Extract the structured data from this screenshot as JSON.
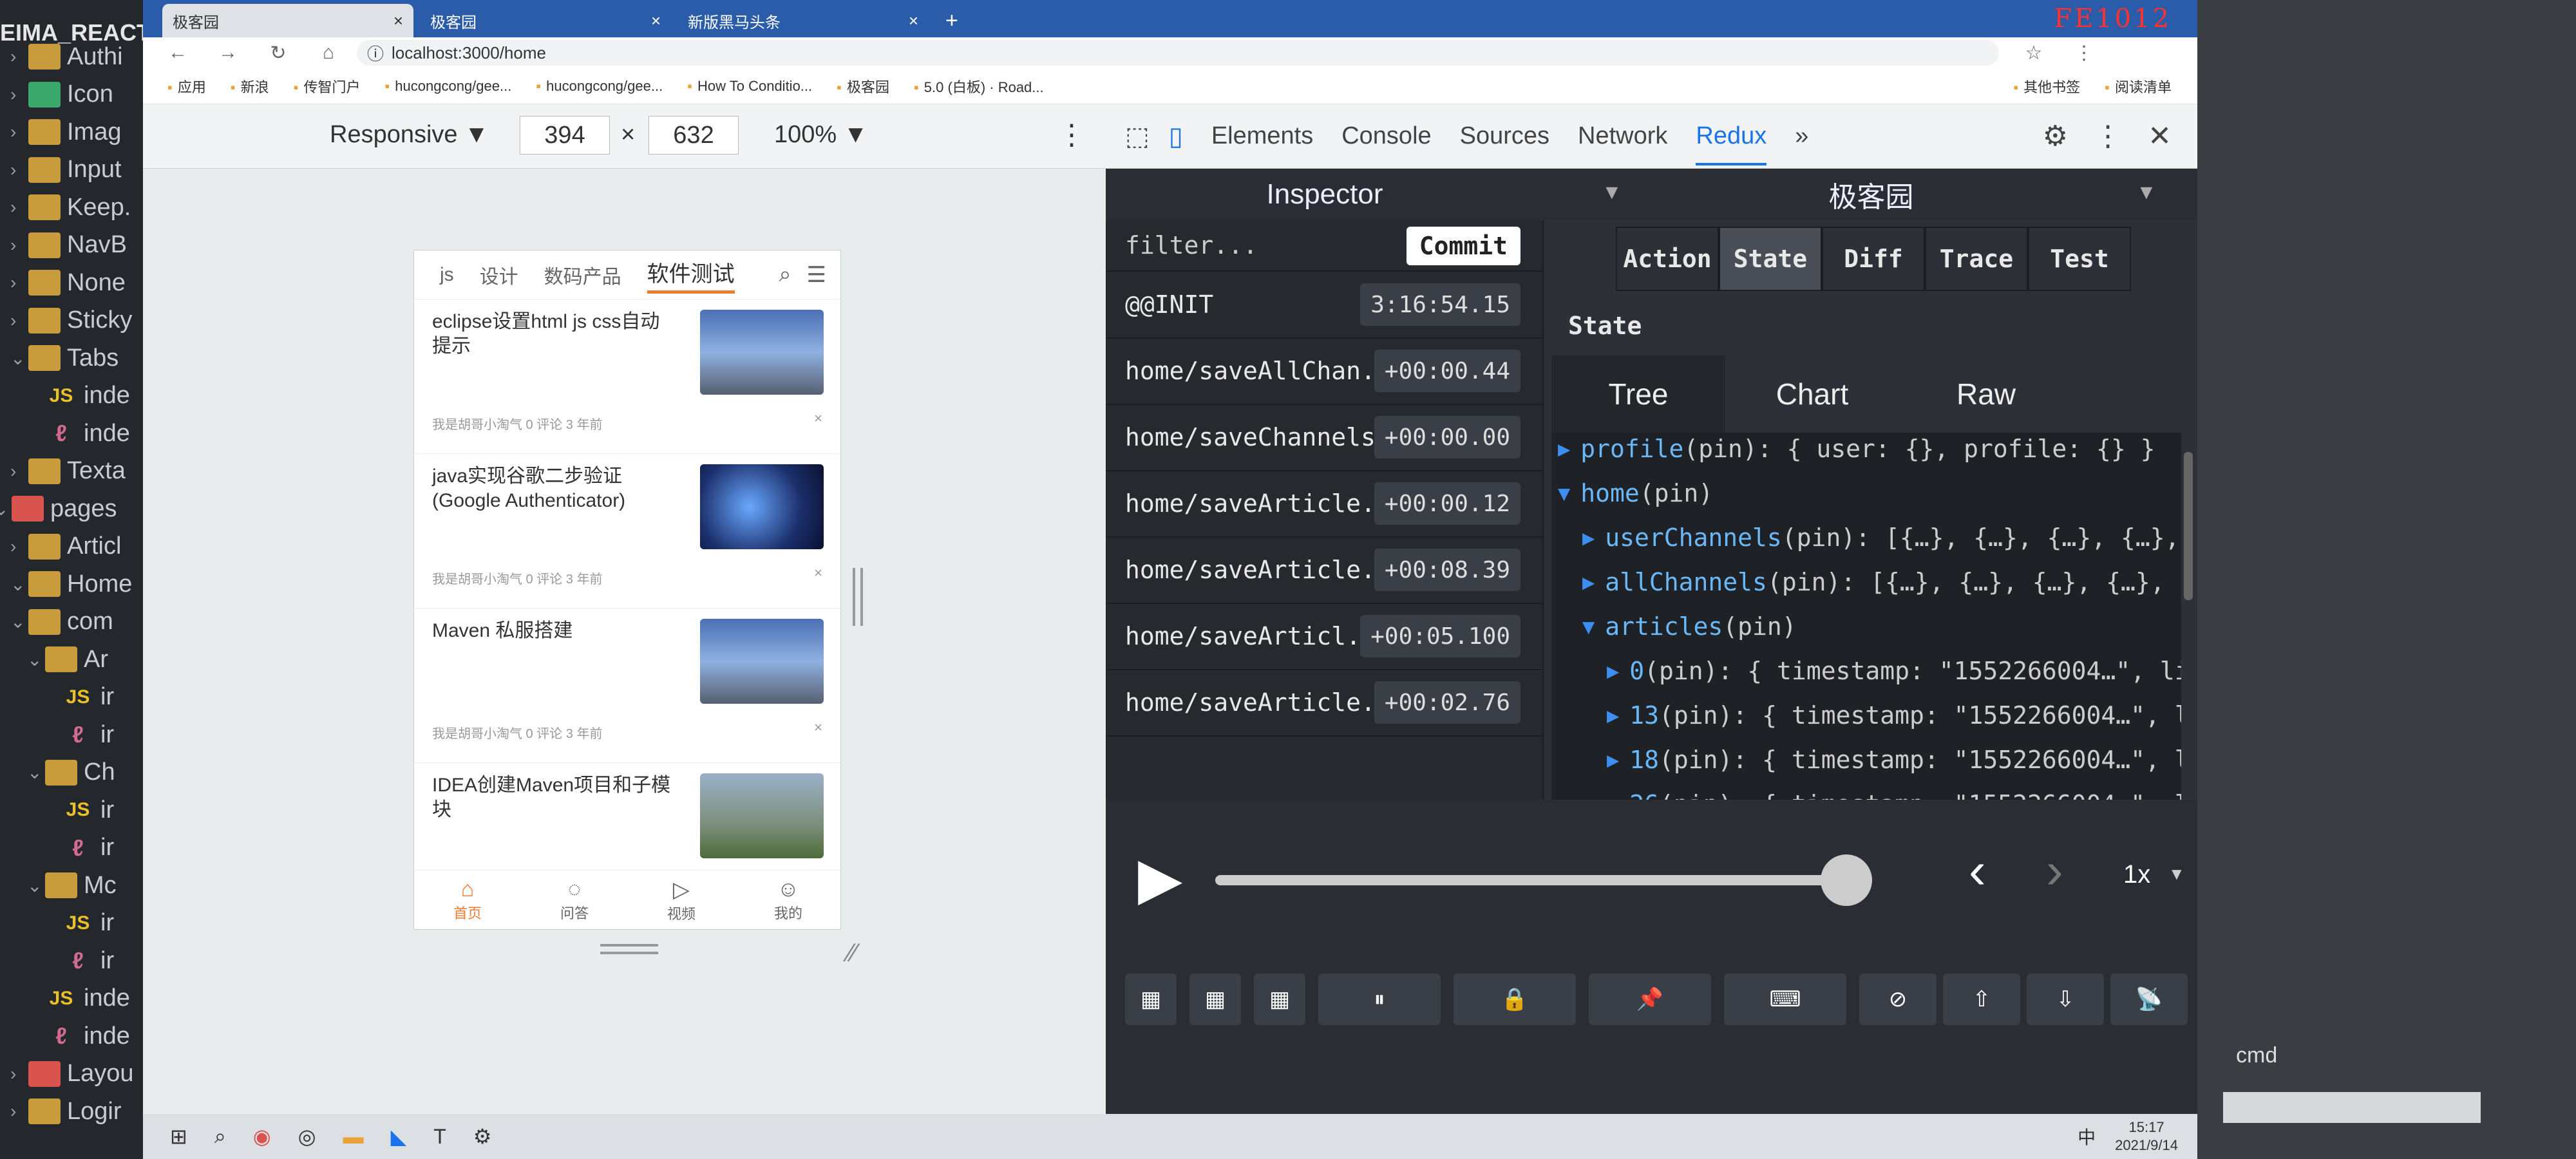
{
  "explorer": {
    "root": "EIMA_REACT",
    "items": [
      {
        "label": "Authi",
        "type": "folder",
        "color": "yellow",
        "chev": "›"
      },
      {
        "label": "Icon",
        "type": "folder",
        "color": "green",
        "chev": "›"
      },
      {
        "label": "Imag",
        "type": "folder",
        "color": "yellow",
        "chev": "›"
      },
      {
        "label": "Input",
        "type": "folder",
        "color": "yellow",
        "chev": "›"
      },
      {
        "label": "Keep.",
        "type": "folder",
        "color": "yellow",
        "chev": "›"
      },
      {
        "label": "NavB",
        "type": "folder",
        "color": "yellow",
        "chev": "›"
      },
      {
        "label": "None",
        "type": "folder",
        "color": "yellow",
        "chev": "›"
      },
      {
        "label": "Sticky",
        "type": "folder",
        "color": "yellow",
        "chev": "›"
      },
      {
        "label": "Tabs",
        "type": "folder",
        "color": "yellow",
        "chev": "⌄"
      },
      {
        "label": "inde",
        "type": "js",
        "chev": ""
      },
      {
        "label": "inde",
        "type": "sass",
        "chev": ""
      },
      {
        "label": "Texta",
        "type": "folder",
        "color": "yellow",
        "chev": "›"
      },
      {
        "label": "pages",
        "type": "folder",
        "color": "red",
        "chev": "⌄"
      },
      {
        "label": "Articl",
        "type": "folder",
        "color": "yellow",
        "chev": "›"
      },
      {
        "label": "Home",
        "type": "folder",
        "color": "yellow",
        "chev": "⌄"
      },
      {
        "label": "com",
        "type": "folder",
        "color": "yellow",
        "chev": "⌄"
      },
      {
        "label": "Ar",
        "type": "folder",
        "color": "yellow",
        "chev": "⌄"
      },
      {
        "label": "ir",
        "type": "js",
        "chev": ""
      },
      {
        "label": "ir",
        "type": "sass",
        "chev": ""
      },
      {
        "label": "Ch",
        "type": "folder",
        "color": "yellow",
        "chev": "⌄"
      },
      {
        "label": "ir",
        "type": "js",
        "chev": ""
      },
      {
        "label": "ir",
        "type": "sass",
        "chev": ""
      },
      {
        "label": "Mc",
        "type": "folder",
        "color": "yellow",
        "chev": "⌄"
      },
      {
        "label": "ir",
        "type": "js",
        "chev": ""
      },
      {
        "label": "ir",
        "type": "sass",
        "chev": ""
      },
      {
        "label": "inde",
        "type": "js",
        "chev": ""
      },
      {
        "label": "inde",
        "type": "sass",
        "chev": ""
      },
      {
        "label": "Layou",
        "type": "folder",
        "color": "red",
        "chev": "›"
      },
      {
        "label": "Logir",
        "type": "folder",
        "color": "yellow",
        "chev": "›"
      }
    ]
  },
  "browser": {
    "tabs": [
      {
        "label": "极客园",
        "active": true
      },
      {
        "label": "极客园",
        "active": false
      },
      {
        "label": "新版黑马头条",
        "active": false
      }
    ],
    "new_tab": "+",
    "rec_text": "FE1012",
    "url": "localhost:3000/home",
    "bookmarks": [
      "应用",
      "新浪",
      "传智门户",
      "hucongcong/gee...",
      "hucongcong/gee...",
      "How To Conditio...",
      "极客园",
      "5.0 (白板) · Road...",
      "其他书签",
      "阅读清单"
    ]
  },
  "device": {
    "mode": "Responsive ▼",
    "width": "394",
    "times": "×",
    "height": "632",
    "zoom": "100% ▼"
  },
  "app": {
    "tabs": [
      "js",
      "设计",
      "数码产品",
      "软件测试"
    ],
    "active_tab": "软件测试",
    "articles": [
      {
        "title": "eclipse设置html js css自动提示",
        "meta": "我是胡哥小淘气   0 评论   3 年前",
        "thumb": "city"
      },
      {
        "title": "java实现谷歌二步验证 (Google Authenticator)",
        "meta": "我是胡哥小淘气   0 评论   3 年前",
        "thumb": "galaxy"
      },
      {
        "title": "Maven 私服搭建",
        "meta": "我是胡哥小淘气   0 评论   3 年前",
        "thumb": "city"
      },
      {
        "title": "IDEA创建Maven项目和子模块",
        "meta": "",
        "thumb": "park"
      }
    ],
    "close": "×",
    "bottom_tabs": [
      {
        "label": "首页",
        "active": true
      },
      {
        "label": "问答",
        "active": false
      },
      {
        "label": "视频",
        "active": false
      },
      {
        "label": "我的",
        "active": false
      }
    ]
  },
  "devtools": {
    "tabs": [
      "Elements",
      "Console",
      "Sources",
      "Network",
      "Redux"
    ],
    "active": "Redux",
    "more": "»",
    "close": "✕"
  },
  "redux": {
    "inspector": "Inspector",
    "store": "极客园",
    "filter_placeholder": "filter...",
    "commit": "Commit",
    "actions": [
      {
        "name": "@@INIT",
        "time": "3:16:54.15"
      },
      {
        "name": "home/saveAllChan...",
        "time": "+00:00.44"
      },
      {
        "name": "home/saveChannels",
        "time": "+00:00.00"
      },
      {
        "name": "home/saveArticle...",
        "time": "+00:00.12"
      },
      {
        "name": "home/saveArticle...",
        "time": "+00:08.39"
      },
      {
        "name": "home/saveArticl...",
        "time": "+00:05.100"
      },
      {
        "name": "home/saveArticle...",
        "time": "+00:02.76"
      }
    ],
    "modes": [
      "Action",
      "State",
      "Diff",
      "Trace",
      "Test"
    ],
    "active_mode": "State",
    "state_label": "State",
    "views": [
      "Tree",
      "Chart",
      "Raw"
    ],
    "active_view": "Tree",
    "tree": [
      {
        "indent": 0,
        "open": false,
        "key": "profile",
        "rest": " (pin): { user: {}, profile: {} }"
      },
      {
        "indent": 0,
        "open": true,
        "key": "home",
        "rest": " (pin)"
      },
      {
        "indent": 1,
        "open": false,
        "key": "userChannels",
        "rest": " (pin): [{…}, {…}, {…}, {…},"
      },
      {
        "indent": 1,
        "open": false,
        "key": "allChannels",
        "rest": " (pin): [{…}, {…}, {…}, {…},"
      },
      {
        "indent": 1,
        "open": true,
        "key": "articles",
        "rest": " (pin)"
      },
      {
        "indent": 2,
        "open": false,
        "key": "0",
        "rest": " (pin): { timestamp: \"1552266004…\", lis"
      },
      {
        "indent": 2,
        "open": false,
        "key": "13",
        "rest": " (pin): { timestamp: \"1552266004…\", li"
      },
      {
        "indent": 2,
        "open": false,
        "key": "18",
        "rest": " (pin): { timestamp: \"1552266004…\", li"
      },
      {
        "indent": 2,
        "open": false,
        "key": "26",
        "rest": " (pin): { timestamp: \"1552266004…\", li"
      }
    ],
    "slider_value": 1.0,
    "speed": "1x",
    "speed_arrow": "▼"
  },
  "taskbar": {
    "time": "15:17",
    "date": "2021/9/14",
    "ime": "中",
    "cmd_label": "cmd"
  },
  "colors": {
    "tabstrip": "#2a5caa",
    "accent_orange": "#f07a2f",
    "redux_bg": "#2a2d33",
    "tree_key": "#6ab8f7",
    "triangle": "#3c8ff0"
  }
}
